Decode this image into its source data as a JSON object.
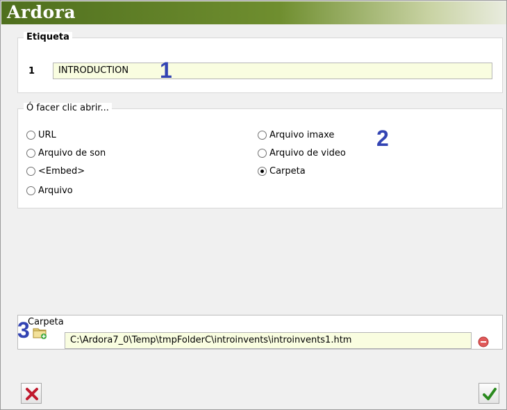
{
  "window": {
    "title": "Ardora"
  },
  "label_group": {
    "legend": "Etiqueta",
    "index": "1",
    "value": "INTRODUCTION"
  },
  "click_group": {
    "legend": "Ó facer clic abrir...",
    "options": [
      {
        "label": "URL",
        "checked": false
      },
      {
        "label": "Arquivo de son",
        "checked": false
      },
      {
        "label": "<Embed>",
        "checked": false
      },
      {
        "label": "Arquivo",
        "checked": false
      },
      {
        "label": "Arquivo imaxe",
        "checked": false
      },
      {
        "label": "Arquivo de video",
        "checked": false
      },
      {
        "label": "Carpeta",
        "checked": true
      }
    ]
  },
  "folder_group": {
    "legend": "Carpeta",
    "path": "C:\\Ardora7_0\\Temp\\tmpFolderC\\introinvents\\introinvents1.htm"
  },
  "markers": {
    "one": "1",
    "two": "2",
    "three": "3"
  },
  "icons": {
    "folder": "folder-add-icon",
    "remove": "remove-icon",
    "cancel": "cancel-x-icon",
    "ok": "ok-check-icon"
  },
  "colors": {
    "title_bar": "#5a7a24",
    "input_bg": "#f9fde0",
    "marker": "#3344b3",
    "cancel": "#c0192d",
    "ok": "#2a8a1e"
  }
}
